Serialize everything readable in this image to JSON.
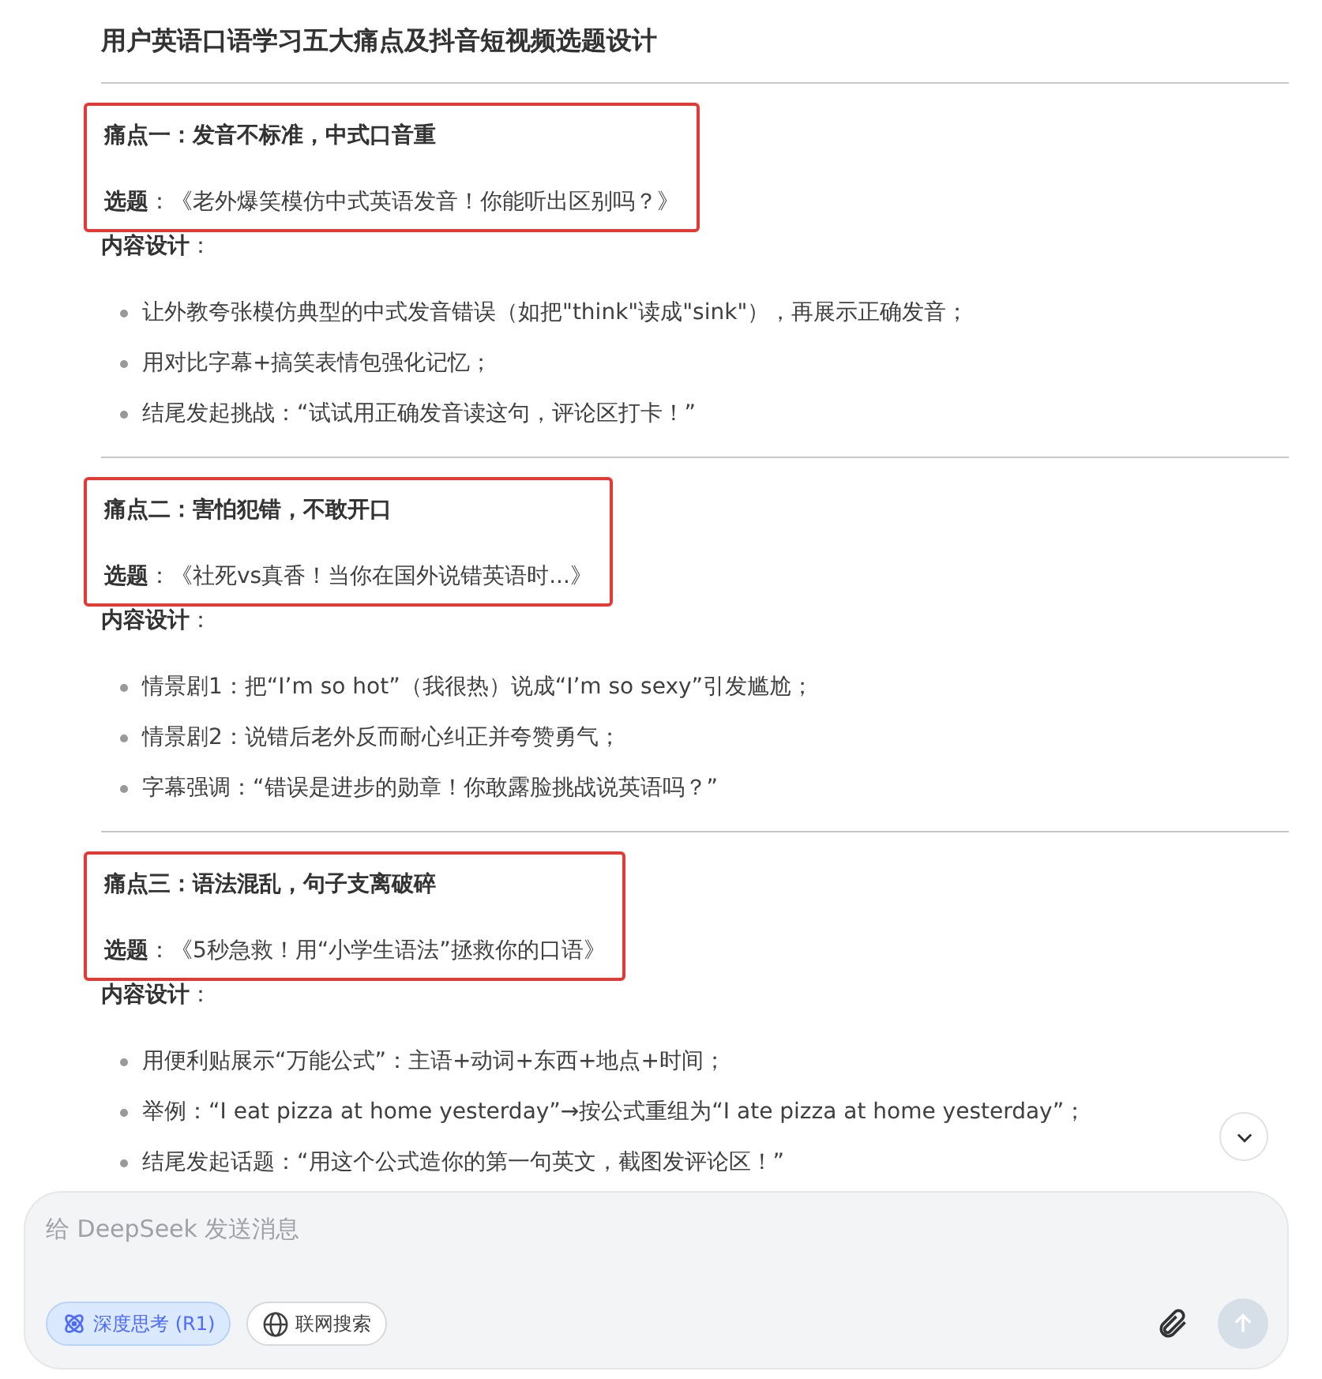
{
  "title": "用户英语口语学习五大痛点及抖音短视频选题设计",
  "sections": [
    {
      "highlighted": true,
      "heading": "痛点一：发音不标准，中式口音重",
      "topic": "**选题**：《老外爆笑模仿中式英语发音！你能听出区别吗？》",
      "design_label": "**内容设计**：",
      "bullets": [
        "让外教夸张模仿典型的中式发音错误（如把\"think\"读成\"sink\"），再展示正确发音；",
        "用对比字幕+搞笑表情包强化记忆；",
        "结尾发起挑战：“试试用正确发音读这句，评论区打卡！”"
      ]
    },
    {
      "highlighted": true,
      "heading": "痛点二：害怕犯错，不敢开口",
      "topic": "**选题**：《社死vs真香！当你在国外说错英语时...》",
      "design_label": "**内容设计**：",
      "bullets": [
        "情景剧1：把“I’m so hot”（我很热）说成“I’m so sexy”引发尴尬；",
        "情景剧2：说错后老外反而耐心纠正并夸赞勇气；",
        "字幕强调：“错误是进步的勋章！你敢露脸挑战说英语吗？”"
      ]
    },
    {
      "highlighted": true,
      "heading": "痛点三：语法混乱，句子支离破碎",
      "topic": "**选题**：《5秒急救！用“小学生语法”拯救你的口语》",
      "design_label": "**内容设计**：",
      "bullets": [
        "用便利贴展示“万能公式”：主语+动词+东西+地点+时间；",
        "举例：“I eat pizza at home yesterday”→按公式重组为“I ate pizza at home yesterday”；",
        "结尾发起话题：“用这个公式造你的第一句英文，截图发评论区！”"
      ]
    }
  ],
  "composer": {
    "placeholder": "给 DeepSeek 发送消息",
    "toggles": [
      {
        "label": "深度思考 (R1)",
        "selected": true
      },
      {
        "label": "联网搜索",
        "selected": false
      }
    ],
    "send_disabled": true
  }
}
